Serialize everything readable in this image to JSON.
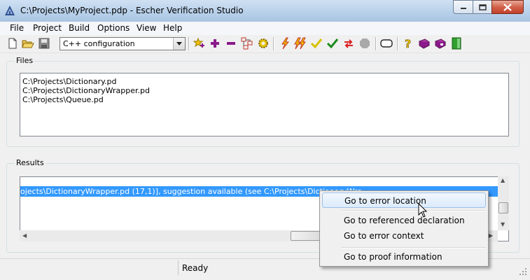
{
  "window": {
    "title": "C:\\Projects\\MyProject.pdp - Escher Verification Studio",
    "controls": {
      "minimize": "minimize",
      "maximize": "maximize",
      "close": "close"
    }
  },
  "menubar": [
    "File",
    "Project",
    "Build",
    "Options",
    "View",
    "Help"
  ],
  "toolbar": {
    "configuration": "C++ configuration",
    "icons": [
      "new-file-icon",
      "open-folder-icon",
      "save-icon",
      "add-files-icon",
      "add-icon",
      "remove-icon",
      "dependency-icon",
      "settings-gear-icon",
      "verify-lightning-icon",
      "verify-all-icon",
      "check-icon",
      "confirm-icon",
      "refresh-icon",
      "stop-icon",
      "comment-icon",
      "help-icon",
      "manual-icon",
      "reference-icon",
      "exit-icon"
    ]
  },
  "files": {
    "label": "Files",
    "items": [
      "C:\\Projects\\Dictionary.pd",
      "C:\\Projects\\DictionaryWrapper.pd",
      "C:\\Projects\\Queue.pd"
    ]
  },
  "results": {
    "label": "Results",
    "selected_row": "ojects\\DictionaryWrapper.pd (17,1)], suggestion available (see C:\\Projects\\DictionaryWra"
  },
  "context_menu": {
    "items": [
      "Go to error location",
      "Go to referenced declaration",
      "Go to error context",
      "Go to proof information"
    ],
    "highlighted_index": 0
  },
  "status": {
    "text": "Ready"
  },
  "colors": {
    "selection": "#3399ff",
    "close_button": "#c2412a",
    "window_bg": "#f0f0f0"
  }
}
